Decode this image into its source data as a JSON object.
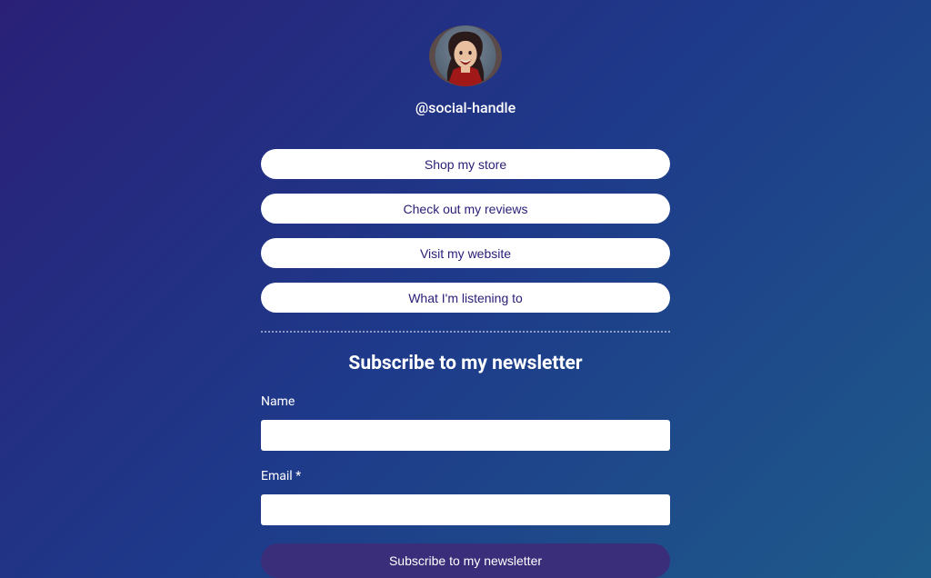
{
  "profile": {
    "avatar_alt": "profile-photo",
    "handle": "@social-handle"
  },
  "links": [
    {
      "label": "Shop my store"
    },
    {
      "label": "Check out my reviews"
    },
    {
      "label": "Visit my website"
    },
    {
      "label": "What I'm listening to"
    }
  ],
  "newsletter": {
    "title": "Subscribe to my newsletter",
    "name_label": "Name",
    "name_value": "",
    "email_label": "Email *",
    "email_value": "",
    "submit_label": "Subscribe to my newsletter"
  }
}
